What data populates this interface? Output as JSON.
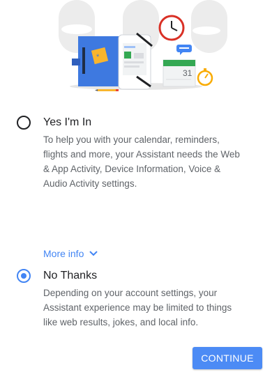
{
  "options": [
    {
      "title": "Yes I'm In",
      "description": "To help you with your calendar, reminders, flights and more, your Assistant needs the Web & App Activity, Device Information, Voice & Audio Activity settings.",
      "selected": false
    },
    {
      "title": "No Thanks",
      "description": "Depending on your account settings, your Assistant experience may be limited to things like web results, jokes, and local info.",
      "selected": true
    }
  ],
  "more_info": {
    "label": "More info",
    "icon": "chevron-down-icon"
  },
  "continue_button": {
    "label": "CONTINUE"
  },
  "illustration": {
    "calendar_day": "31"
  },
  "colors": {
    "accent": "#4285f4",
    "button": "#4c8bf5",
    "title_text": "#202124",
    "body_text": "#5f6368"
  }
}
